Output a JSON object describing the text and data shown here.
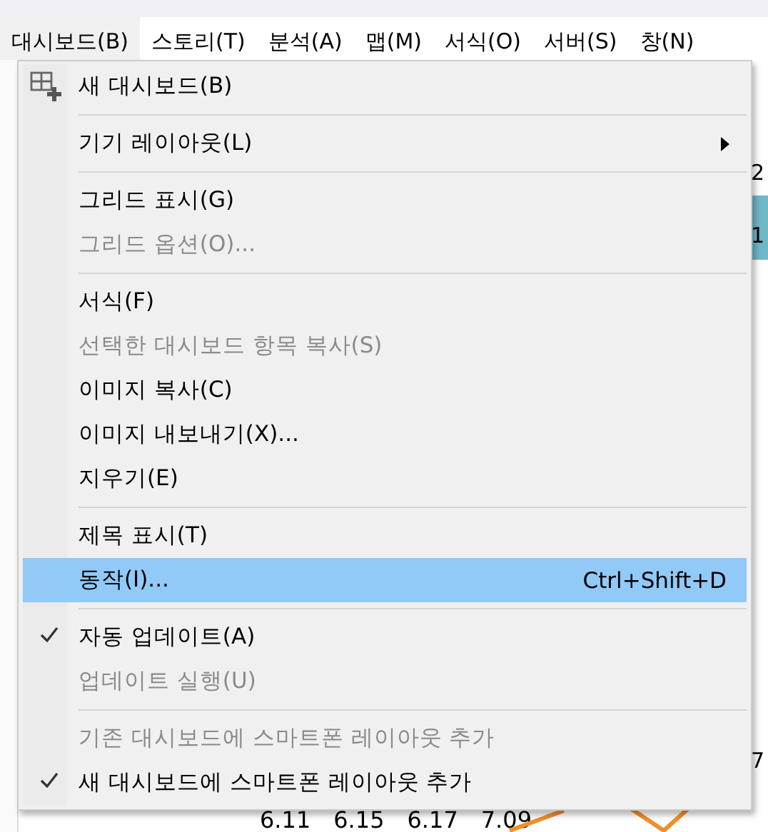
{
  "menu_bar": [
    {
      "label": "대시보드(B)",
      "selected": true
    },
    {
      "label": "스토리(T)",
      "selected": false
    },
    {
      "label": "분석(A)",
      "selected": false
    },
    {
      "label": "맵(M)",
      "selected": false
    },
    {
      "label": "서식(O)",
      "selected": false
    },
    {
      "label": "서버(S)",
      "selected": false
    },
    {
      "label": "창(N)",
      "selected": false
    }
  ],
  "background": {
    "edge_texts": [
      "2",
      "1",
      "7"
    ],
    "bottom_values": [
      "6.11",
      "6.15",
      "6.17",
      "7.09"
    ]
  },
  "menu": {
    "items": [
      {
        "kind": "item",
        "label": "새 대시보드(B)",
        "disabled": false,
        "checked": false,
        "selected": false
      },
      {
        "kind": "separator"
      },
      {
        "kind": "submenu",
        "label": "기기 레이아웃(L)",
        "disabled": false,
        "checked": false,
        "selected": false
      },
      {
        "kind": "separator"
      },
      {
        "kind": "item",
        "label": "그리드 표시(G)",
        "disabled": false,
        "checked": false,
        "selected": false
      },
      {
        "kind": "item",
        "label": "그리드 옵션(O)...",
        "disabled": true,
        "checked": false,
        "selected": false
      },
      {
        "kind": "separator"
      },
      {
        "kind": "item",
        "label": "서식(F)",
        "disabled": false,
        "checked": false,
        "selected": false
      },
      {
        "kind": "item",
        "label": "선택한 대시보드 항목 복사(S)",
        "disabled": true,
        "checked": false,
        "selected": false
      },
      {
        "kind": "item",
        "label": "이미지 복사(C)",
        "disabled": false,
        "checked": false,
        "selected": false
      },
      {
        "kind": "item",
        "label": "이미지 내보내기(X)...",
        "disabled": false,
        "checked": false,
        "selected": false
      },
      {
        "kind": "item",
        "label": "지우기(E)",
        "disabled": false,
        "checked": false,
        "selected": false
      },
      {
        "kind": "separator"
      },
      {
        "kind": "item",
        "label": "제목 표시(T)",
        "disabled": false,
        "checked": false,
        "selected": false
      },
      {
        "kind": "item",
        "label": "동작(I)...",
        "shortcut": "Ctrl+Shift+D",
        "disabled": false,
        "checked": false,
        "selected": true
      },
      {
        "kind": "separator"
      },
      {
        "kind": "item",
        "label": "자동 업데이트(A)",
        "disabled": false,
        "checked": true,
        "selected": false
      },
      {
        "kind": "item",
        "label": "업데이트 실행(U)",
        "disabled": true,
        "checked": false,
        "selected": false
      },
      {
        "kind": "separator"
      },
      {
        "kind": "item",
        "label": "기존 대시보드에 스마트폰 레이아웃 추가",
        "disabled": true,
        "checked": false,
        "selected": false
      },
      {
        "kind": "item",
        "label": "새 대시보드에 스마트폰 레이아웃 추가",
        "disabled": false,
        "checked": true,
        "selected": false
      }
    ]
  }
}
